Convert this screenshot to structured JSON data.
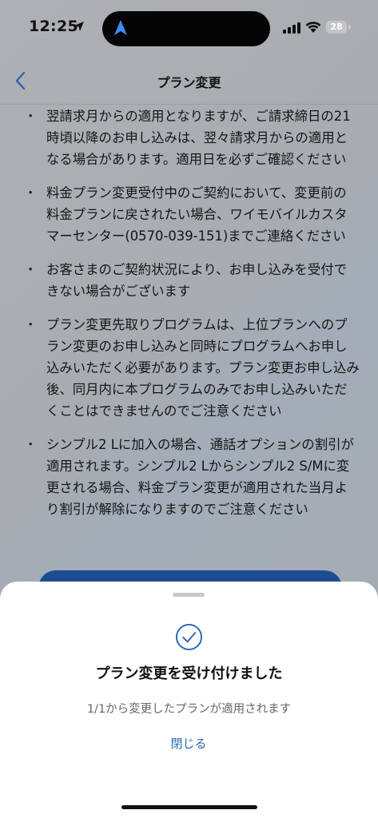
{
  "status_bar": {
    "time": "12:25",
    "battery": "28"
  },
  "header": {
    "title": "プラン変更",
    "back_icon": "chevron-left-icon"
  },
  "notes": [
    "翌請求月からの適用となりますが、ご請求締日の21時頃以降のお申し込みは、翌々請求月からの適用となる場合があります。適用日を必ずご確認ください",
    "料金プラン変更受付中のご契約において、変更前の料金プランに戻されたい場合、ワイモバイルカスタマーセンター(0570-039-151)までご連絡ください",
    "お客さまのご契約状況により、お申し込みを受付できない場合がございます",
    "プラン変更先取りプログラムは、上位プランへのプラン変更のお申し込みと同時にプログラムへお申し込みいただく必要があります。プラン変更お申し込み後、同月内に本プログラムのみでお申し込みいただくことはできませんのでご注意ください",
    "シンプル2 Lに加入の場合、通話オプションの割引が適用されます。シンプル2 Lからシンプル2 S/Mに変更される場合、料金プラン変更が適用された当月より割引が解除になりますのでご注意ください"
  ],
  "bullet": "・",
  "sheet": {
    "icon": "check-circle-icon",
    "title": "プラン変更を受け付けました",
    "message": "1/1から変更したプランが適用されます",
    "close_label": "閉じる"
  },
  "colors": {
    "accent": "#2a66b5",
    "primary_button": "#1d4c92",
    "overlay": "#a9acb1"
  }
}
